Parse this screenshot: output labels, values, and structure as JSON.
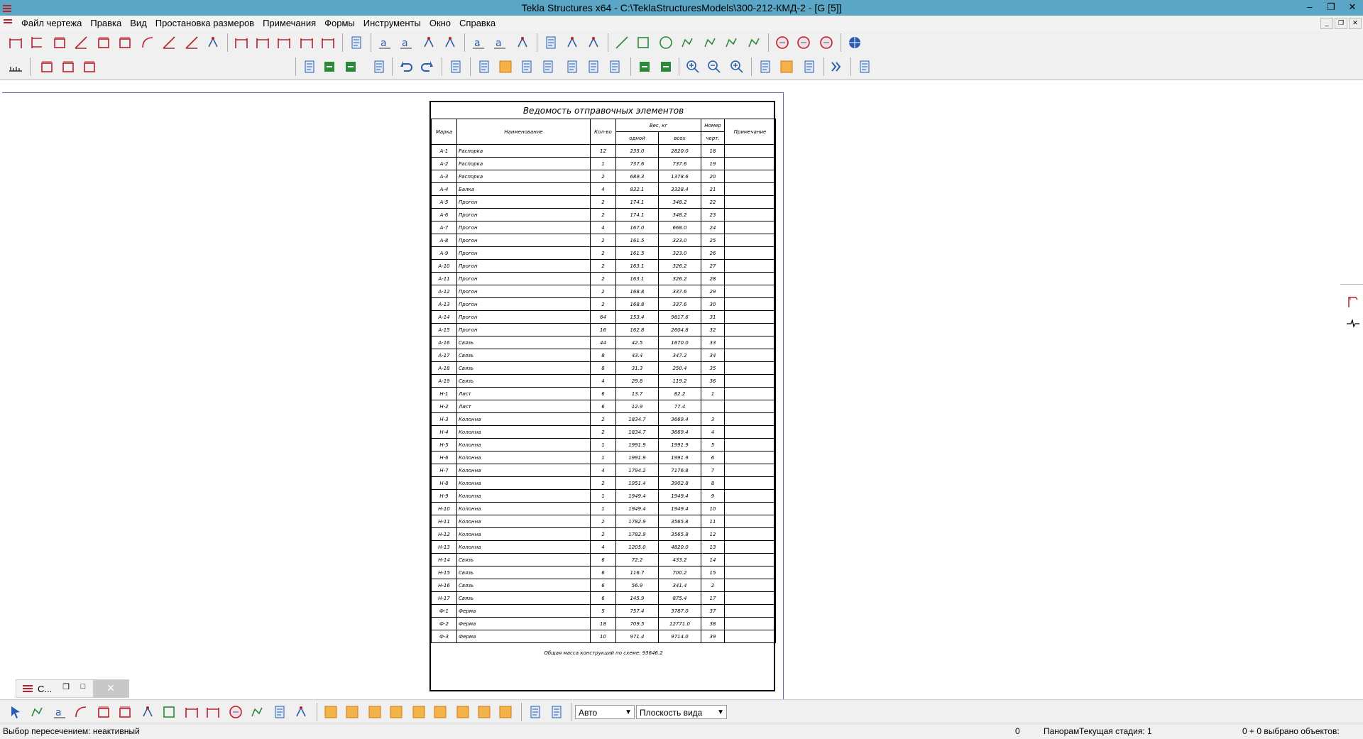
{
  "window": {
    "title": "Tekla Structures x64 - C:\\TeklaStructuresModels\\300-212-КМД-2  - [G   [5]]"
  },
  "menu": [
    "Файл чертежа",
    "Правка",
    "Вид",
    "Простановка размеров",
    "Примечания",
    "Формы",
    "Инструменты",
    "Окно",
    "Справка"
  ],
  "table": {
    "title": "Ведомость отправочных элементов",
    "headers": {
      "mark": "Марка",
      "name": "Наименование",
      "qty": "Кол-во",
      "weight": "Вес, кг",
      "weight_one": "одной",
      "weight_all": "всех",
      "sheet_no_1": "Номер",
      "sheet_no_2": "черт.",
      "note": "Примечание"
    },
    "rows": [
      [
        "А-1",
        "Распорка",
        "12",
        "235.0",
        "2820.0",
        "18"
      ],
      [
        "А-2",
        "Распорка",
        "1",
        "737.6",
        "737.6",
        "19"
      ],
      [
        "А-3",
        "Распорка",
        "2",
        "689.3",
        "1378.6",
        "20"
      ],
      [
        "А-4",
        "Балка",
        "4",
        "832.1",
        "3328.4",
        "21"
      ],
      [
        "А-5",
        "Прогон",
        "2",
        "174.1",
        "348.2",
        "22"
      ],
      [
        "А-6",
        "Прогон",
        "2",
        "174.1",
        "348.2",
        "23"
      ],
      [
        "А-7",
        "Прогон",
        "4",
        "167.0",
        "668.0",
        "24"
      ],
      [
        "А-8",
        "Прогон",
        "2",
        "161.5",
        "323.0",
        "25"
      ],
      [
        "А-9",
        "Прогон",
        "2",
        "161.5",
        "323.0",
        "26"
      ],
      [
        "А-10",
        "Прогон",
        "2",
        "163.1",
        "326.2",
        "27"
      ],
      [
        "А-11",
        "Прогон",
        "2",
        "163.1",
        "326.2",
        "28"
      ],
      [
        "А-12",
        "Прогон",
        "2",
        "168.8",
        "337.6",
        "29"
      ],
      [
        "А-13",
        "Прогон",
        "2",
        "168.8",
        "337.6",
        "30"
      ],
      [
        "А-14",
        "Прогон",
        "64",
        "153.4",
        "9817.6",
        "31"
      ],
      [
        "А-15",
        "Прогон",
        "16",
        "162.8",
        "2604.8",
        "32"
      ],
      [
        "А-16",
        "Связь",
        "44",
        "42.5",
        "1870.0",
        "33"
      ],
      [
        "А-17",
        "Связь",
        "8",
        "43.4",
        "347.2",
        "34"
      ],
      [
        "А-18",
        "Связь",
        "8",
        "31.3",
        "250.4",
        "35"
      ],
      [
        "А-19",
        "Связь",
        "4",
        "29.8",
        "119.2",
        "36"
      ],
      [
        "Н-1",
        "Лист",
        "6",
        "13.7",
        "82.2",
        "1"
      ],
      [
        "Н-2",
        "Лист",
        "6",
        "12.9",
        "77.4",
        ""
      ],
      [
        "Н-3",
        "Колонна",
        "2",
        "1834.7",
        "3669.4",
        "3"
      ],
      [
        "Н-4",
        "Колонна",
        "2",
        "1834.7",
        "3669.4",
        "4"
      ],
      [
        "Н-5",
        "Колонна",
        "1",
        "1991.9",
        "1991.9",
        "5"
      ],
      [
        "Н-6",
        "Колонна",
        "1",
        "1991.9",
        "1991.9",
        "6"
      ],
      [
        "Н-7",
        "Колонна",
        "4",
        "1794.2",
        "7176.8",
        "7"
      ],
      [
        "Н-8",
        "Колонна",
        "2",
        "1951.4",
        "3902.8",
        "8"
      ],
      [
        "Н-9",
        "Колонна",
        "1",
        "1949.4",
        "1949.4",
        "9"
      ],
      [
        "Н-10",
        "Колонна",
        "1",
        "1949.4",
        "1949.4",
        "10"
      ],
      [
        "Н-11",
        "Колонна",
        "2",
        "1782.9",
        "3565.8",
        "11"
      ],
      [
        "Н-12",
        "Колонна",
        "2",
        "1782.9",
        "3565.8",
        "12"
      ],
      [
        "Н-13",
        "Колонна",
        "4",
        "1205.0",
        "4820.0",
        "13"
      ],
      [
        "Н-14",
        "Связь",
        "6",
        "72.2",
        "433.2",
        "14"
      ],
      [
        "Н-15",
        "Связь",
        "6",
        "116.7",
        "700.2",
        "15"
      ],
      [
        "Н-16",
        "Связь",
        "6",
        "56.9",
        "341.4",
        "2"
      ],
      [
        "Н-17",
        "Связь",
        "6",
        "145.9",
        "875.4",
        "17"
      ],
      [
        "Ф-1",
        "Ферма",
        "5",
        "757.4",
        "3787.0",
        "37"
      ],
      [
        "Ф-2",
        "Ферма",
        "18",
        "709.5",
        "12771.0",
        "38"
      ],
      [
        "Ф-3",
        "Ферма",
        "10",
        "971.4",
        "9714.0",
        "39"
      ]
    ],
    "footer": "Общая масса конструкций по схеме: 93646.2"
  },
  "taskmini": {
    "label": "C..."
  },
  "bottom": {
    "combo1": "Авто",
    "combo2": "Плоскость вида"
  },
  "status": {
    "left": "Выбор пересечением: неактивный",
    "count": "0",
    "pan": "Панорам",
    "stage": "Текущая стадия: 1",
    "selected": "0 + 0 выбрано объектов:"
  },
  "colors": {
    "titlebar": "#5ba6c4",
    "toolbar": "#f0f0f0",
    "icon_red": "#b8202a",
    "icon_blue": "#2a5db0"
  }
}
